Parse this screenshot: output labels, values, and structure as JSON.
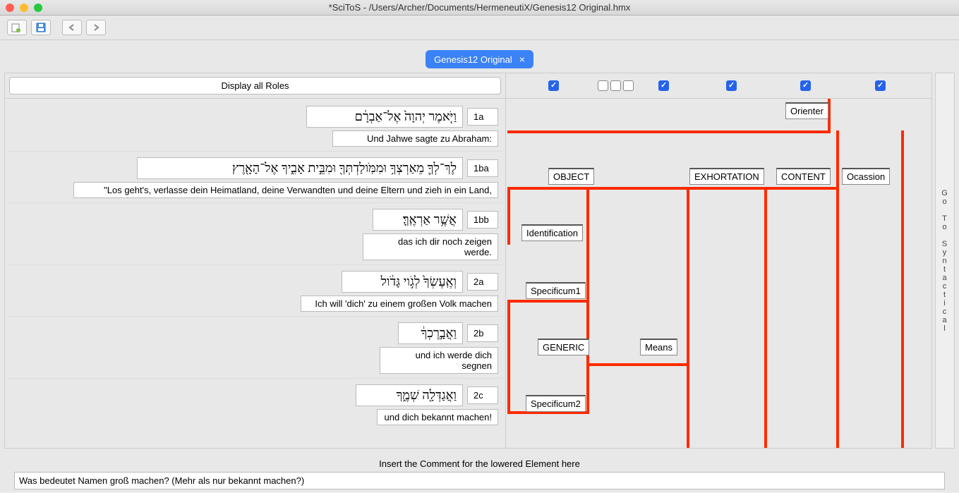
{
  "window": {
    "title": "*SciToS - /Users/Archer/Documents/HermeneutiX/Genesis12 Original.hmx"
  },
  "tab": {
    "label": "Genesis12 Original",
    "close": "×"
  },
  "rolesButton": "Display all Roles",
  "rows": [
    {
      "hebrew": "וַיֹּ֤אמֶר יְהוָה֙ אֶל־אַבְרָ֔ם",
      "ref": "1a",
      "trans": "Und Jahwe sagte zu Abraham:"
    },
    {
      "hebrew": "לֶךְ־לְךָ֛ מֵאַרְצְךָ֥ וּמִמֹּֽולַדְתְּךָ֖ וּמִבֵּ֣ית אָבִ֑יךָ אֶל־הָאָ֖רֶץ",
      "ref": "1ba",
      "trans": "\"Los geht's, verlasse dein Heimatland, deine Verwandten und deine Eltern und zieh in ein Land,"
    },
    {
      "hebrew": "אֲשֶׁ֥ר אַרְאֶֽךָּ׃",
      "ref": "1bb",
      "trans": "das ich dir noch zeigen werde."
    },
    {
      "hebrew": "וְאֶֽעֶשְׂךָ֙ לְגֹ֣וי גָּדֹ֔ול",
      "ref": "2a",
      "trans": "Ich will 'dich' zu einem großen Volk machen"
    },
    {
      "hebrew": "וַאֲבָ֣רֶכְךָ֔",
      "ref": "2b",
      "trans": "und ich werde dich segnen"
    },
    {
      "hebrew": "וַאֲגַדְּלָ֖ה שְׁמֶ֑ךָ",
      "ref": "2c",
      "trans": "und dich bekannt machen!"
    }
  ],
  "labels": {
    "orienter": "Orienter",
    "object": "OBJECT",
    "exhortation": "EXHORTATION",
    "content": "CONTENT",
    "ocassion": "Ocassion",
    "identification": "Identification",
    "specificum1": "Specificum1",
    "generic": "GENERIC",
    "means": "Means",
    "specificum2": "Specificum2"
  },
  "sideNav": "Go To Syntactical",
  "footer": {
    "label": "Insert the Comment for the lowered Element here",
    "comment": "Was bedeutet Namen groß machen? (Mehr als nur bekannt machen?)"
  }
}
